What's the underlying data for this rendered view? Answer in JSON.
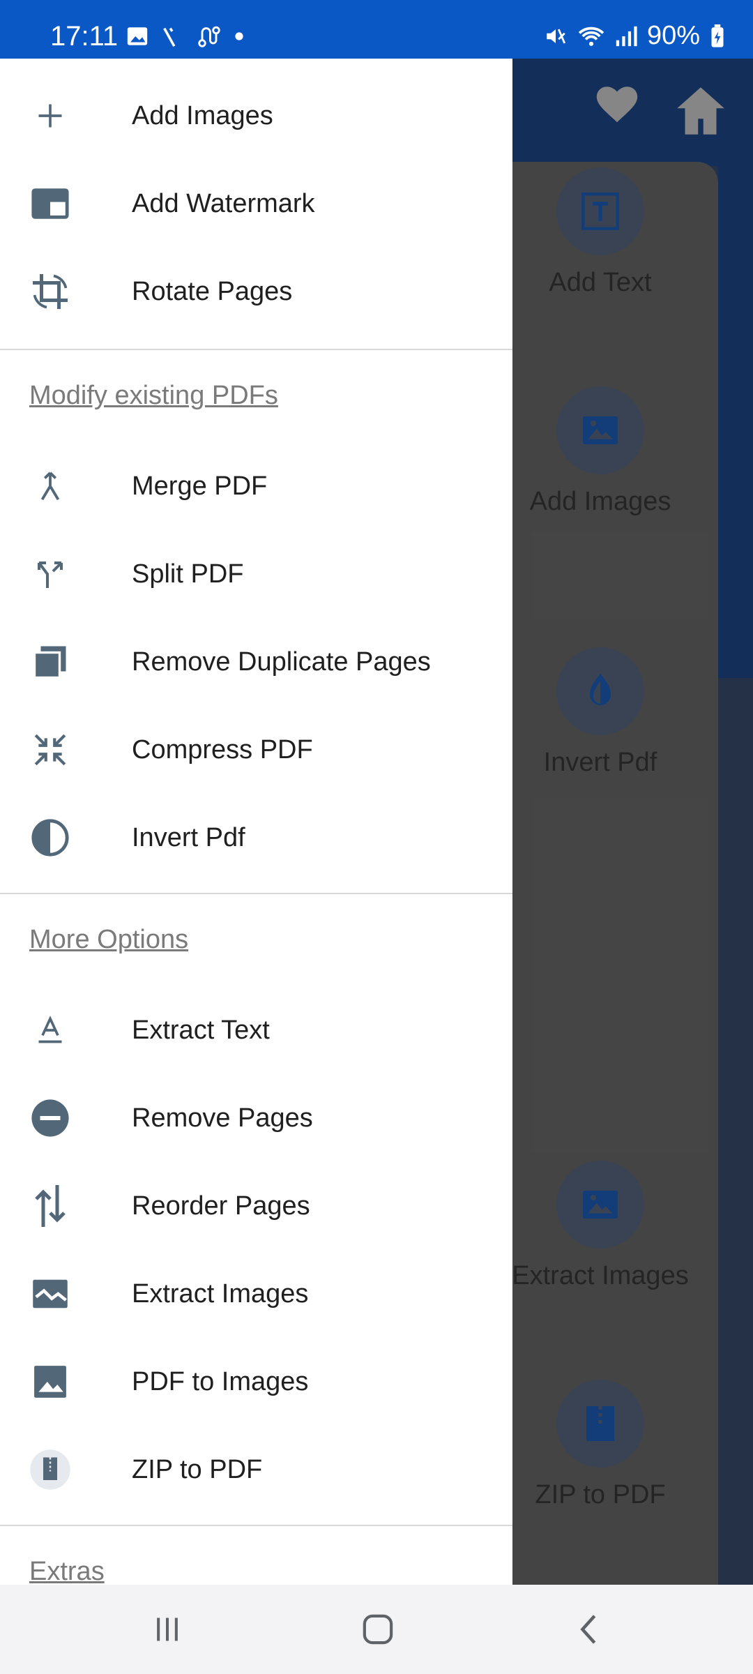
{
  "status_bar": {
    "time": "17:11",
    "battery": "90%",
    "icons_left": [
      "image-icon",
      "signal-slash-icon",
      "route-icon",
      "dot-icon"
    ],
    "icons_right": [
      "mute-icon",
      "wifi-icon",
      "cell-signal-icon",
      "battery-charging-icon"
    ]
  },
  "background": {
    "header_icons": [
      "heart-icon",
      "home-icon"
    ],
    "items": [
      {
        "label": "Add Text",
        "icon": "text-box-icon"
      },
      {
        "label": "Add Images",
        "icon": "image-icon"
      },
      {
        "label": "Invert Pdf",
        "icon": "invert-drop-icon"
      },
      {
        "label": "Extract Images",
        "icon": "image-icon"
      },
      {
        "label": "ZIP to PDF",
        "icon": "zip-file-icon"
      }
    ]
  },
  "drawer": {
    "top_items": [
      {
        "label": "Add Images",
        "icon": "plus-icon"
      },
      {
        "label": "Add Watermark",
        "icon": "watermark-icon"
      },
      {
        "label": "Rotate Pages",
        "icon": "rotate-icon"
      }
    ],
    "section_modify": {
      "title": "Modify existing PDFs",
      "items": [
        {
          "label": "Merge PDF",
          "icon": "merge-icon"
        },
        {
          "label": "Split PDF",
          "icon": "split-icon"
        },
        {
          "label": "Remove Duplicate Pages",
          "icon": "duplicate-pages-icon"
        },
        {
          "label": "Compress PDF",
          "icon": "compress-icon"
        },
        {
          "label": "Invert Pdf",
          "icon": "invert-icon"
        }
      ]
    },
    "section_more": {
      "title": "More Options",
      "items": [
        {
          "label": "Extract Text",
          "icon": "text-format-icon"
        },
        {
          "label": "Remove Pages",
          "icon": "minus-circle-icon"
        },
        {
          "label": "Reorder Pages",
          "icon": "reorder-arrows-icon"
        },
        {
          "label": "Extract Images",
          "icon": "extract-image-icon"
        },
        {
          "label": "PDF to Images",
          "icon": "image-icon"
        },
        {
          "label": "ZIP to PDF",
          "icon": "zip-icon"
        }
      ]
    },
    "section_extras": {
      "title": "Extras"
    }
  },
  "nav_bar": {
    "buttons": [
      "recents-icon",
      "home-button-icon",
      "back-icon"
    ]
  },
  "colors": {
    "status_bar": "#0a58c5",
    "icon_gray": "#526778",
    "icon_blue": "#1e63c4"
  }
}
